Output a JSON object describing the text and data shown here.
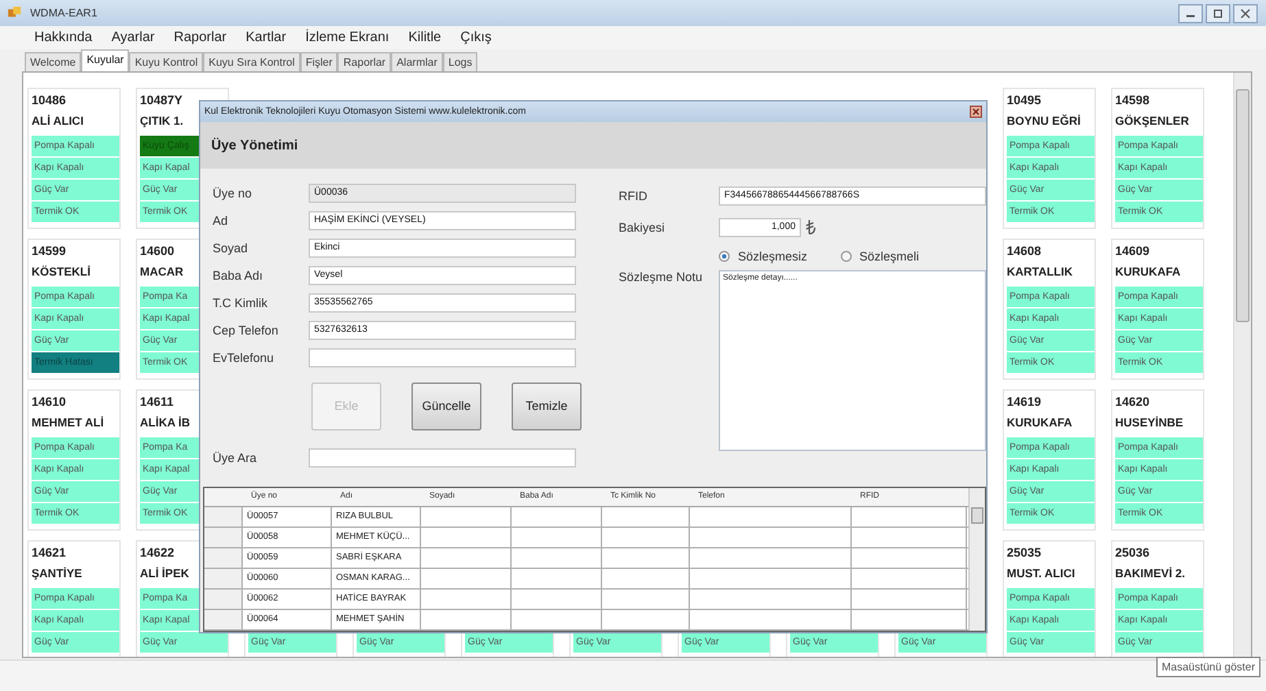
{
  "window": {
    "title": "WDMA-EAR1"
  },
  "menu": [
    "Hakkında",
    "Ayarlar",
    "Raporlar",
    "Kartlar",
    "İzleme Ekranı",
    "Kilitle",
    "Çıkış"
  ],
  "tabs": [
    {
      "label": "Welcome",
      "selected": false
    },
    {
      "label": "Kuyular",
      "selected": true
    },
    {
      "label": "Kuyu Kontrol",
      "selected": false
    },
    {
      "label": "Kuyu Sıra Kontrol",
      "selected": false
    },
    {
      "label": "Fişler",
      "selected": false
    },
    {
      "label": "Raporlar",
      "selected": false
    },
    {
      "label": "Alarmlar",
      "selected": false
    },
    {
      "label": "Logs",
      "selected": false
    }
  ],
  "well_rows": [
    {
      "left": [
        {
          "number": "10486",
          "name": "ALİ ALICI",
          "pompa": {
            "text": "Pompa Kapalı",
            "kind": "ok"
          },
          "kapi": {
            "text": "Kapı Kapalı",
            "kind": "ok"
          },
          "guc": {
            "text": "Güç Var",
            "kind": "ok"
          },
          "termik": {
            "text": "Termik OK",
            "kind": "ok"
          }
        },
        {
          "number": "10487Y",
          "name": "ÇITIK 1.",
          "pompa": {
            "text": "Kuyu Çalış",
            "kind": "running"
          },
          "kapi": {
            "text": "Kapı Kapal",
            "kind": "ok"
          },
          "guc": {
            "text": "Güç Var",
            "kind": "ok"
          },
          "termik": {
            "text": "Termik OK",
            "kind": "ok"
          }
        }
      ],
      "right": [
        {
          "number": "10495",
          "name": "BOYNU EĞRİ",
          "pompa": {
            "text": "Pompa Kapalı",
            "kind": "ok"
          },
          "kapi": {
            "text": "Kapı Kapalı",
            "kind": "ok"
          },
          "guc": {
            "text": "Güç Var",
            "kind": "ok"
          },
          "termik": {
            "text": "Termik OK",
            "kind": "ok"
          }
        },
        {
          "number": "14598",
          "name": "GÖKŞENLER",
          "pompa": {
            "text": "Pompa Kapalı",
            "kind": "ok"
          },
          "kapi": {
            "text": "Kapı Kapalı",
            "kind": "ok"
          },
          "guc": {
            "text": "Güç Var",
            "kind": "ok"
          },
          "termik": {
            "text": "Termik OK",
            "kind": "ok"
          }
        }
      ]
    },
    {
      "left": [
        {
          "number": "14599",
          "name": "KÖSTEKLİ",
          "pompa": {
            "text": "Pompa Kapalı",
            "kind": "ok"
          },
          "kapi": {
            "text": "Kapı Kapalı",
            "kind": "ok"
          },
          "guc": {
            "text": "Güç Var",
            "kind": "ok"
          },
          "termik": {
            "text": "Termik Hatası",
            "kind": "fault"
          }
        },
        {
          "number": "14600",
          "name": "MACAR",
          "pompa": {
            "text": "Pompa Ka",
            "kind": "ok"
          },
          "kapi": {
            "text": "Kapı Kapal",
            "kind": "ok"
          },
          "guc": {
            "text": "Güç Var",
            "kind": "ok"
          },
          "termik": {
            "text": "Termik OK",
            "kind": "ok"
          }
        }
      ],
      "right": [
        {
          "number": "14608",
          "name": "KARTALLIK",
          "pompa": {
            "text": "Pompa Kapalı",
            "kind": "ok"
          },
          "kapi": {
            "text": "Kapı Kapalı",
            "kind": "ok"
          },
          "guc": {
            "text": "Güç Var",
            "kind": "ok"
          },
          "termik": {
            "text": "Termik OK",
            "kind": "ok"
          }
        },
        {
          "number": "14609",
          "name": "KURUKAFA",
          "pompa": {
            "text": "Pompa Kapalı",
            "kind": "ok"
          },
          "kapi": {
            "text": "Kapı Kapalı",
            "kind": "ok"
          },
          "guc": {
            "text": "Güç Var",
            "kind": "ok"
          },
          "termik": {
            "text": "Termik OK",
            "kind": "ok"
          }
        }
      ]
    },
    {
      "left": [
        {
          "number": "14610",
          "name": "MEHMET ALİ",
          "pompa": {
            "text": "Pompa Kapalı",
            "kind": "ok"
          },
          "kapi": {
            "text": "Kapı Kapalı",
            "kind": "ok"
          },
          "guc": {
            "text": "Güç Var",
            "kind": "ok"
          },
          "termik": {
            "text": "Termik OK",
            "kind": "ok"
          }
        },
        {
          "number": "14611",
          "name": "ALİKA İB",
          "pompa": {
            "text": "Pompa Ka",
            "kind": "ok"
          },
          "kapi": {
            "text": "Kapı Kapal",
            "kind": "ok"
          },
          "guc": {
            "text": "Güç Var",
            "kind": "ok"
          },
          "termik": {
            "text": "Termik OK",
            "kind": "ok"
          }
        }
      ],
      "right": [
        {
          "number": "14619",
          "name": "KURUKAFA",
          "pompa": {
            "text": "Pompa Kapalı",
            "kind": "ok"
          },
          "kapi": {
            "text": "Kapı Kapalı",
            "kind": "ok"
          },
          "guc": {
            "text": "Güç Var",
            "kind": "ok"
          },
          "termik": {
            "text": "Termik OK",
            "kind": "ok"
          }
        },
        {
          "number": "14620",
          "name": "HUSEYİNBE",
          "pompa": {
            "text": "Pompa Kapalı",
            "kind": "ok"
          },
          "kapi": {
            "text": "Kapı Kapalı",
            "kind": "ok"
          },
          "guc": {
            "text": "Güç Var",
            "kind": "ok"
          },
          "termik": {
            "text": "Termik OK",
            "kind": "ok"
          }
        }
      ]
    },
    {
      "left": [
        {
          "number": "14621",
          "name": "ŞANTİYE",
          "pompa": {
            "text": "Pompa Kapalı",
            "kind": "ok"
          },
          "kapi": {
            "text": "Kapı Kapalı",
            "kind": "ok"
          },
          "guc": {
            "text": "Güç Var",
            "kind": "ok"
          }
        },
        {
          "number": "14622",
          "name": "ALİ İPEK",
          "pompa": {
            "text": "Pompa Ka",
            "kind": "ok"
          },
          "kapi": {
            "text": "Kapı Kapal",
            "kind": "ok"
          },
          "guc": {
            "text": "Güç Var",
            "kind": "ok"
          }
        }
      ],
      "middle": [
        {
          "guc": {
            "text": "Güç Var",
            "kind": "ok"
          }
        },
        {
          "guc": {
            "text": "Güç Var",
            "kind": "ok"
          }
        },
        {
          "guc": {
            "text": "Güç Var",
            "kind": "ok"
          }
        },
        {
          "guc": {
            "text": "Güç Var",
            "kind": "ok"
          }
        },
        {
          "guc": {
            "text": "Güç Var",
            "kind": "ok"
          }
        },
        {
          "guc": {
            "text": "Güç Var",
            "kind": "ok"
          }
        },
        {
          "guc": {
            "text": "Güç Var",
            "kind": "ok"
          }
        }
      ],
      "right": [
        {
          "number": "25035",
          "name": "MUST. ALICI",
          "pompa": {
            "text": "Pompa Kapalı",
            "kind": "ok"
          },
          "kapi": {
            "text": "Kapı Kapalı",
            "kind": "ok"
          },
          "guc": {
            "text": "Güç Var",
            "kind": "ok"
          }
        },
        {
          "number": "25036",
          "name": "BAKIMEVİ 2.",
          "pompa": {
            "text": "Pompa Kapalı",
            "kind": "ok"
          },
          "kapi": {
            "text": "Kapı Kapalı",
            "kind": "ok"
          },
          "guc": {
            "text": "Güç Var",
            "kind": "ok"
          }
        }
      ]
    }
  ],
  "dialog": {
    "title": "Kul Elektronik Teknolojileri  Kuyu Otomasyon Sistemi www.kulelektronik.com",
    "heading": "Üye Yönetimi",
    "fields": [
      {
        "label": "Üye no",
        "value": "Ü00036",
        "disabled": true
      },
      {
        "label": "Ad",
        "value": "HAŞİM EKİNCİ (VEYSEL)",
        "disabled": false
      },
      {
        "label": "Soyad",
        "value": "Ekinci",
        "disabled": false
      },
      {
        "label": "Baba Adı",
        "value": "Veysel",
        "disabled": false
      },
      {
        "label": "T.C Kimlik",
        "value": "35535562765",
        "disabled": false
      },
      {
        "label": "Cep Telefon",
        "value": "5327632613",
        "disabled": false
      },
      {
        "label": "EvTelefonu",
        "disabled": false
      }
    ],
    "buttons": [
      {
        "label": "Ekle",
        "disabled": true
      },
      {
        "label": "Güncelle",
        "disabled": false
      },
      {
        "label": "Temizle",
        "disabled": false
      }
    ],
    "search_label": "Üye Ara",
    "rfid": {
      "label": "RFID",
      "value": "F34456678865444566788766S"
    },
    "balance": {
      "label": "Bakiyesi",
      "value": "1,000"
    },
    "contract_options": [
      {
        "label": "Sözleşmesiz",
        "selected": true
      },
      {
        "label": "Sözleşmeli",
        "selected": false
      }
    ],
    "note": {
      "label": "Sözleşme Notu",
      "value": "Sözleşme detayı......"
    },
    "table": {
      "columns": [
        "Üye no",
        "Adı",
        "Soyadı",
        "Baba Adı",
        "Tc Kimlik No",
        "Telefon",
        "RFID"
      ],
      "rows": [
        [
          "Ü00057",
          "RIZA BULBUL"
        ],
        [
          "Ü00058",
          "MEHMET KÜÇÜ..."
        ],
        [
          "Ü00059",
          "SABRİ EŞKARA"
        ],
        [
          "Ü00060",
          "OSMAN KARAG..."
        ],
        [
          "Ü00062",
          "HATİCE BAYRAK"
        ],
        [
          "Ü00064",
          "MEHMET ŞAHİN"
        ]
      ]
    }
  },
  "tooltip": "Masaüstünü göster"
}
